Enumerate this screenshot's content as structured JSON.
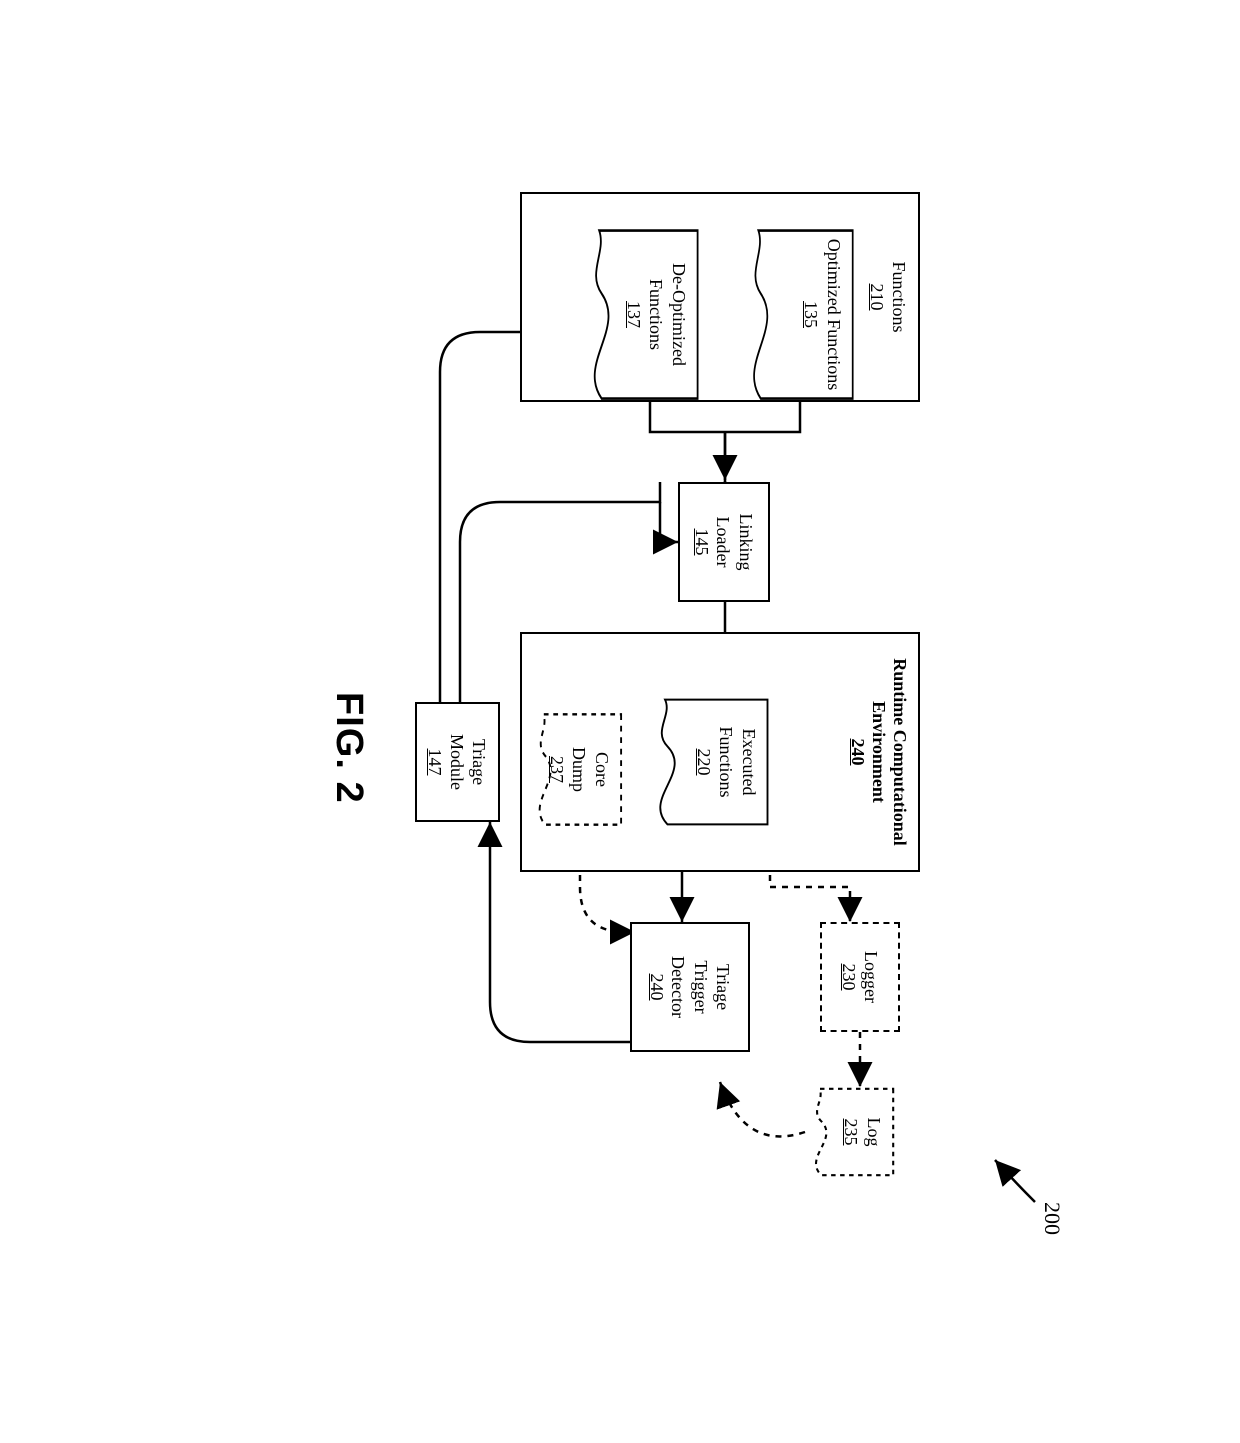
{
  "figure_ref": "200",
  "figure_label": "FIG. 2",
  "functions": {
    "title": "Functions",
    "id": "210",
    "optimized": {
      "title": "Optimized Functions",
      "id": "135"
    },
    "deoptimized": {
      "title": "De-Optimized Functions",
      "id": "137"
    }
  },
  "linking_loader": {
    "title": "Linking Loader",
    "id": "145"
  },
  "runtime_env": {
    "title": "Runtime Computational Environment",
    "id": "240",
    "executed": {
      "title": "Executed Functions",
      "id": "220"
    },
    "core_dump": {
      "title": "Core Dump",
      "id": "237"
    }
  },
  "logger": {
    "title": "Logger",
    "id": "230"
  },
  "log": {
    "title": "Log",
    "id": "235"
  },
  "triage_trigger": {
    "title": "Triage Trigger Detector",
    "id": "240"
  },
  "triage_module": {
    "title": "Triage Module",
    "id": "147"
  }
}
